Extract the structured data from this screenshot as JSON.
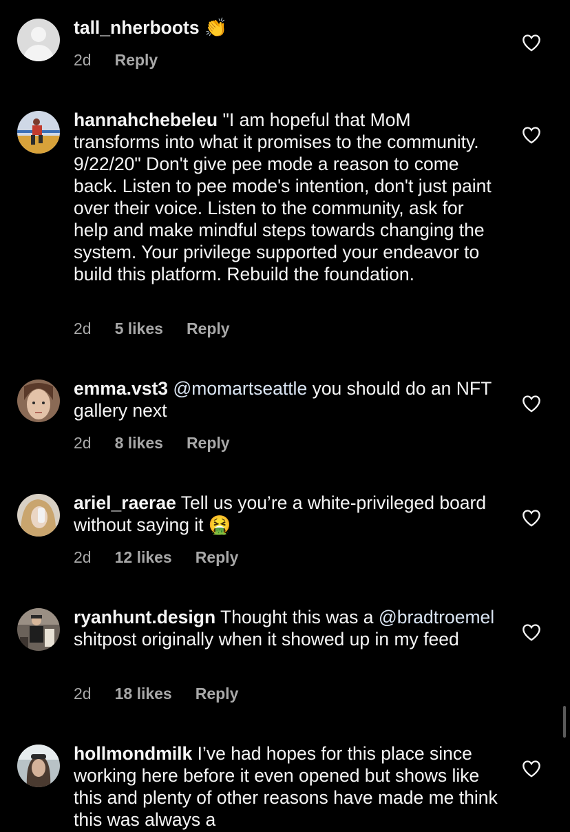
{
  "comments": [
    {
      "username": "tall_nherboots",
      "text": "",
      "emoji": "👏",
      "time": "2d",
      "likes": "",
      "reply": "Reply"
    },
    {
      "username": "hannahchebeleu",
      "text": "\"I am hopeful that MoM transforms into what it promises to the community. 9/22/20\" Don't give pee mode a reason to come back. Listen to pee mode's intention, don't just paint over their voice. Listen to the community, ask for help and make mindful steps towards changing the system. Your privilege supported your endeavor to build this platform. Rebuild the foundation.",
      "time": "2d",
      "likes": "5 likes",
      "reply": "Reply"
    },
    {
      "username": "emma.vst3",
      "mention": "@momartseattle",
      "text": "you should do an NFT gallery next",
      "time": "2d",
      "likes": "8 likes",
      "reply": "Reply"
    },
    {
      "username": "ariel_raerae",
      "text": "Tell us you’re a white-privileged board without saying it",
      "emoji": "🤮",
      "time": "2d",
      "likes": "12 likes",
      "reply": "Reply"
    },
    {
      "username": "ryanhunt.design",
      "text_before": "Thought this was a",
      "mention": "@bradtroemel",
      "text": "shitpost originally when it showed up in my feed",
      "time": "2d",
      "likes": "18 likes",
      "reply": "Reply"
    },
    {
      "username": "hollmondmilk",
      "text": "I’ve had hopes for this place since working here before it even opened but shows like this and plenty of other reasons have made me think this was always a",
      "time": "",
      "likes": "",
      "reply": ""
    }
  ],
  "icons": {
    "like": "heart-outline-icon"
  },
  "colors": {
    "background": "#000000",
    "text": "#f5f5f5",
    "meta": "#a8a8a8",
    "mention": "#d9e4f2"
  }
}
